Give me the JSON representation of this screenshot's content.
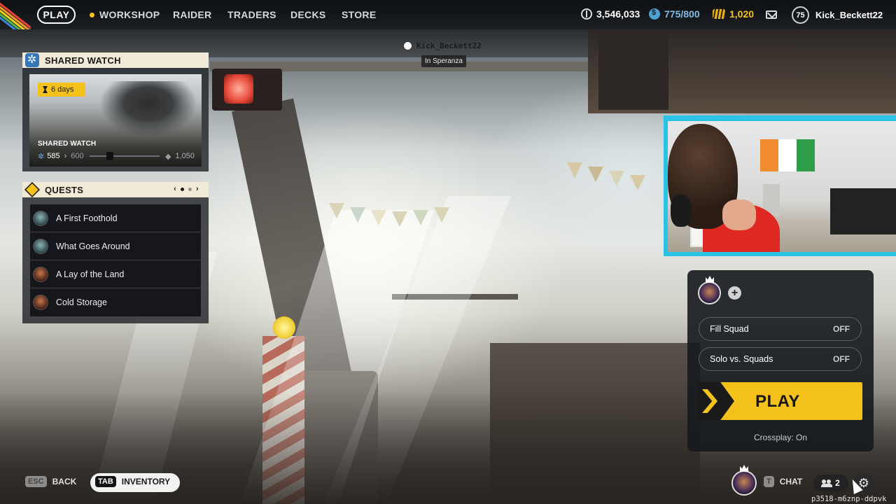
{
  "topnav": {
    "play": "PLAY",
    "items": [
      "WORKSHOP",
      "RAIDER",
      "TRADERS",
      "DECKS",
      "STORE"
    ],
    "currency_coins": "3,546,033",
    "currency_tokens": "775/800",
    "currency_gold": "1,020",
    "level": "75",
    "username": "Kick_Beckett22"
  },
  "player_tag": {
    "name": "Kick_Beckett22",
    "location": "In Speranza"
  },
  "shared_watch": {
    "header": "SHARED WATCH",
    "days": "6  days",
    "label": "SHARED WATCH",
    "current": "585",
    "next": "600",
    "goal": "1,050"
  },
  "quests": {
    "header": "QUESTS",
    "prev": "‹",
    "next": "›",
    "items": [
      {
        "title": "A First Foothold",
        "avatar": "teal"
      },
      {
        "title": "What Goes Around",
        "avatar": "teal"
      },
      {
        "title": "A Lay of the Land",
        "avatar": "red"
      },
      {
        "title": "Cold Storage",
        "avatar": "red"
      }
    ]
  },
  "squad": {
    "add": "+",
    "fill_squad_label": "Fill Squad",
    "fill_squad_value": "OFF",
    "solo_label": "Solo vs. Squads",
    "solo_value": "OFF",
    "play_label": "PLAY",
    "crossplay": "Crossplay: On"
  },
  "bottom": {
    "esc_key": "ESC",
    "back": "BACK",
    "tab_key": "TAB",
    "inventory": "INVENTORY",
    "chat_key": "T",
    "chat": "CHAT",
    "friends_count": "2",
    "session_id": "p3518-m6znp-ddpvk"
  },
  "colors": {
    "accent": "#f5c21b",
    "webcam_border": "#29c3e6",
    "panel_header": "#f1ead6"
  }
}
